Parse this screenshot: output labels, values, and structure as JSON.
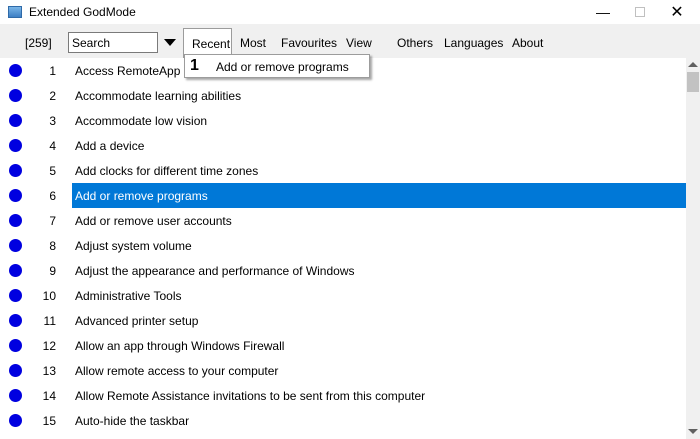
{
  "window": {
    "title": "Extended GodMode",
    "minimize": "—",
    "close": "✕"
  },
  "toolbar": {
    "count": "[259]",
    "search_value": "Search",
    "menu": [
      "Recent",
      "Most",
      "Favourites",
      "View",
      "Others",
      "Languages",
      "About"
    ]
  },
  "recent_popup": {
    "number": "1",
    "item": "Add or remove programs"
  },
  "list": {
    "selected_index": 6,
    "items": [
      {
        "num": "1",
        "label": "Access RemoteApp and"
      },
      {
        "num": "2",
        "label": "Accommodate learning abilities"
      },
      {
        "num": "3",
        "label": "Accommodate low vision"
      },
      {
        "num": "4",
        "label": "Add a device"
      },
      {
        "num": "5",
        "label": "Add clocks for different time zones"
      },
      {
        "num": "6",
        "label": "Add or remove programs"
      },
      {
        "num": "7",
        "label": "Add or remove user accounts"
      },
      {
        "num": "8",
        "label": "Adjust system volume"
      },
      {
        "num": "9",
        "label": "Adjust the appearance and performance of Windows"
      },
      {
        "num": "10",
        "label": "Administrative Tools"
      },
      {
        "num": "11",
        "label": "Advanced printer setup"
      },
      {
        "num": "12",
        "label": "Allow an app through Windows Firewall"
      },
      {
        "num": "13",
        "label": "Allow remote access to your computer"
      },
      {
        "num": "14",
        "label": "Allow Remote Assistance invitations to be sent from this computer"
      },
      {
        "num": "15",
        "label": "Auto-hide the taskbar"
      }
    ]
  },
  "colors": {
    "selection": "#0078d7",
    "dot": "#0000e0"
  }
}
